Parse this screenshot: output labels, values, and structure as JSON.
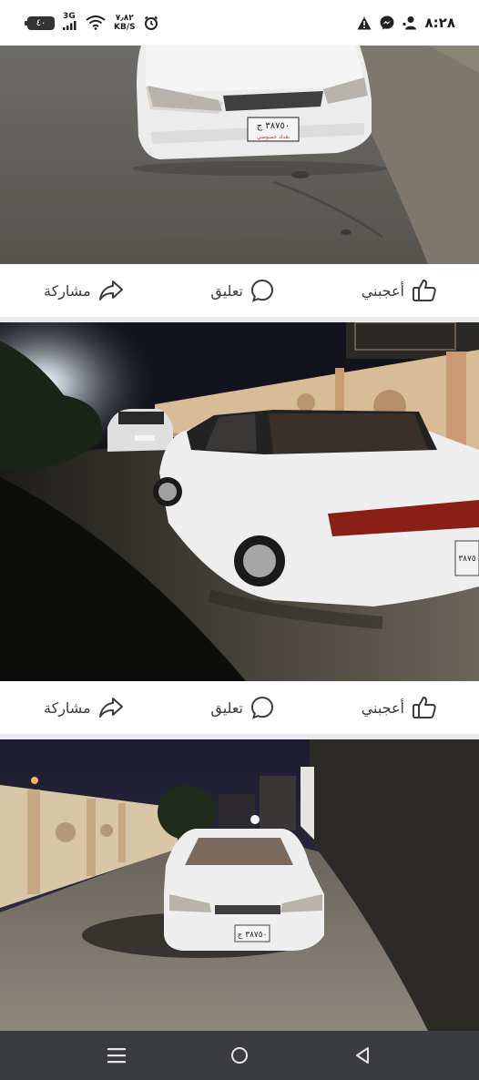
{
  "status_bar": {
    "battery": "٤٠",
    "network_type": "3G",
    "net_speed_value": "٧٫٨٢",
    "net_speed_unit": "KB/S",
    "time": "٨:٢٨",
    "icons": [
      "battery-icon",
      "signal-icon",
      "wifi-icon",
      "alarm-icon",
      "warning-icon",
      "messenger-icon",
      "person-notification-icon"
    ]
  },
  "posts": [
    {
      "like_label": "أعجبني",
      "comment_label": "تعليق",
      "share_label": "مشاركة"
    },
    {
      "like_label": "أعجبني",
      "comment_label": "تعليق",
      "share_label": "مشاركة"
    }
  ],
  "photos": [
    {
      "plate_text": "٣٨٧٥٠ ج",
      "plate_sub": "بغداد خصوصي"
    },
    {
      "plate_text": "٣٨٧٥",
      "plate_sub": ""
    },
    {
      "plate_text": "٣٨٧٥٠ ج",
      "plate_sub": ""
    }
  ],
  "nav_bar": {
    "icons": [
      "menu-icon",
      "home-icon",
      "back-icon"
    ]
  },
  "colors": {
    "action_text": "#3a3b3d",
    "nav_bg": "#3b3c3f",
    "status_bg": "#ffffff"
  }
}
